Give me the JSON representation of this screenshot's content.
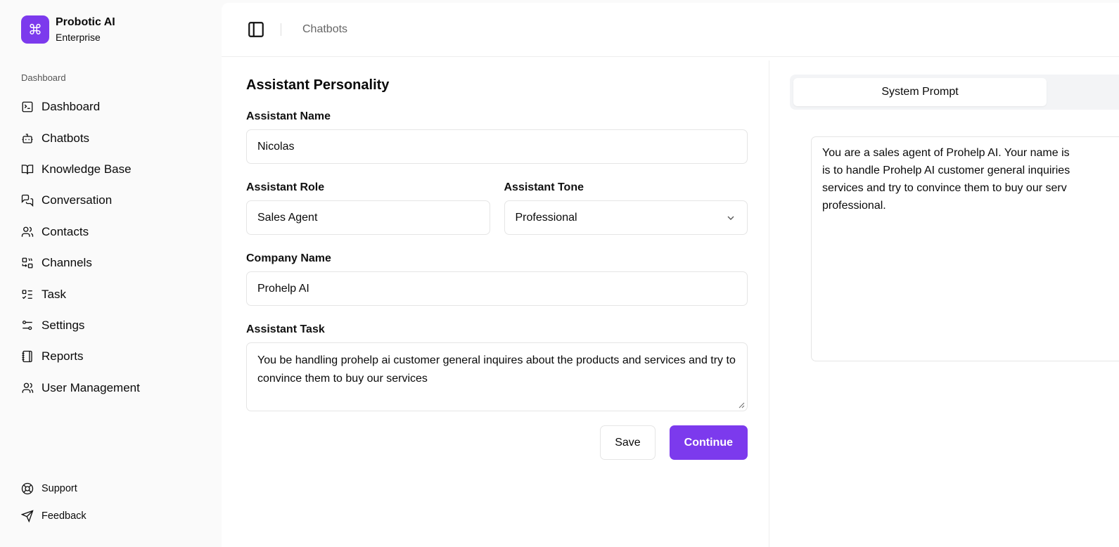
{
  "sidebar": {
    "brand": "Probotic AI",
    "plan": "Enterprise",
    "logo_icon": "command-icon",
    "group_label": "Dashboard",
    "items": [
      {
        "label": "Dashboard",
        "icon": "terminal-icon"
      },
      {
        "label": "Chatbots",
        "icon": "bot-icon"
      },
      {
        "label": "Knowledge Base",
        "icon": "book-icon"
      },
      {
        "label": "Conversation",
        "icon": "messages-icon"
      },
      {
        "label": "Contacts",
        "icon": "users-icon"
      },
      {
        "label": "Channels",
        "icon": "channels-icon"
      },
      {
        "label": "Task",
        "icon": "list-todo-icon"
      },
      {
        "label": "Settings",
        "icon": "sliders-icon"
      },
      {
        "label": "Reports",
        "icon": "notebook-icon"
      },
      {
        "label": "User Management",
        "icon": "user-management-icon"
      }
    ],
    "footer": [
      {
        "label": "Support",
        "icon": "life-buoy-icon"
      },
      {
        "label": "Feedback",
        "icon": "send-icon"
      }
    ]
  },
  "header": {
    "breadcrumb": "Chatbots"
  },
  "form": {
    "title": "Assistant Personality",
    "name_label": "Assistant Name",
    "name_value": "Nicolas",
    "role_label": "Assistant Role",
    "role_value": "Sales Agent",
    "tone_label": "Assistant Tone",
    "tone_value": "Professional",
    "company_label": "Company Name",
    "company_value": "Prohelp AI",
    "task_label": "Assistant Task",
    "task_value": "You be handling prohelp ai customer general inquires about the products and services and try to convince them to buy our services",
    "save": "Save",
    "continue": "Continue"
  },
  "preview": {
    "tab_active": "System Prompt",
    "prompt_lines": [
      "You are a sales agent of Prohelp AI. Your name is",
      "is to handle Prohelp AI customer general inquiries",
      "services and try to convince them to buy our serv",
      "professional."
    ]
  },
  "colors": {
    "accent": "#7c3aed"
  }
}
